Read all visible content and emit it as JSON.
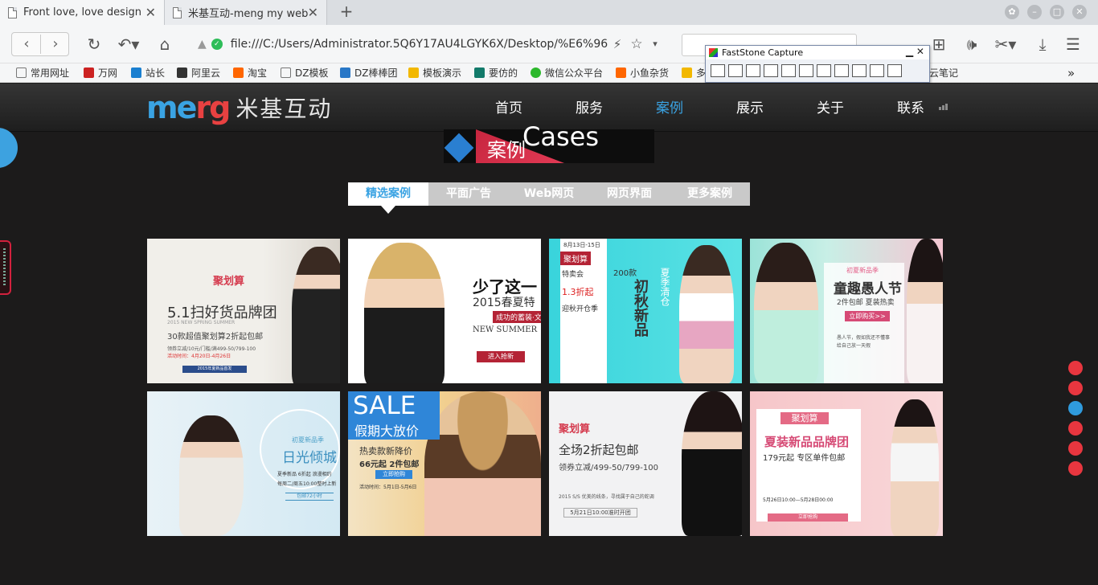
{
  "browser": {
    "tabs": [
      {
        "label": "Front love, love design"
      },
      {
        "label": "米基互动-meng my web..."
      }
    ],
    "address": "file:///C:/Users/Administrator.5Q6Y17AU4LGYK6X/Desktop/%E6%96",
    "bookmarks": [
      "常用网址",
      "万网",
      "站长",
      "阿里云",
      "淘宝",
      "DZ模板",
      "DZ棒棒团",
      "模板演示",
      "要仿的",
      "微信公众平台",
      "小鱼杂货",
      "多",
      "云笔记"
    ]
  },
  "faststone": {
    "title": "FastStone Capture"
  },
  "site": {
    "logo_en": "merg",
    "logo_cn": "米基互动",
    "menu": [
      "首页",
      "服务",
      "案例",
      "展示",
      "关于",
      "联系"
    ],
    "heading_cn": "案例",
    "heading_en": "Cases",
    "filters": [
      "精选案例",
      "平面广告",
      "Web网页",
      "网页界面",
      "更多案例"
    ],
    "cases": [
      {
        "title": "聚划算",
        "line1": "5.1扫好货品牌团",
        "line2": "2015 NEW SPRING SUMMER",
        "line3": "30款超值聚划算2折起包邮",
        "line4": "领券立减/10元/门槛/满499-50/799-100",
        "line5": "活动时间：4月20日-4月26日",
        "line6": "2015年夏新品首发"
      },
      {
        "title": "少了这一",
        "line1": "2015春夏特",
        "line2": "成功的蓄装·文",
        "line3": "NEW SUMMER",
        "btn": "进入抢新"
      },
      {
        "title": "8月13日-15日",
        "line1": "聚划算",
        "line2": "特卖会",
        "line3": "1.3折起",
        "line4": "迎秋开仓季",
        "line5": "200款",
        "line6": "初秋新品",
        "line7": "夏季清仓"
      },
      {
        "title": "初夏新品季",
        "line1": "童趣愚人节",
        "line2": "2件包邮   夏装热卖",
        "btn": "立即购买>>",
        "line3": "愚人节，假如我还不懂事",
        "line4": "给自己放一天假"
      },
      {
        "title": "初夏新品季",
        "line1": "日光倾城",
        "line2": "夏季新品 6折起 浪漫相约",
        "line3": "每周二/周五10:00整时上新",
        "btn": "包邮72小时"
      },
      {
        "title": "SALE",
        "line1": "假期大放价",
        "line2": "热卖款新降价",
        "line3": "66元起 2件包邮",
        "btn": "立即抢购",
        "line4": "活动时间：5月1日-5月6日"
      },
      {
        "title": "聚划算",
        "line1": "全场2折起包邮",
        "line2": "领券立减/499-50/799-100",
        "line3": "2015 S/S 优美的线条，寻找属于自己的蛇调",
        "line4": "5月21日10:00准时开团"
      },
      {
        "title": "聚划算",
        "line1": "夏装新品品牌团",
        "line2": "179元起   专区单件包邮",
        "line3": "5月26日10:00—5月28日00:00",
        "btn": "立即抢购"
      }
    ]
  },
  "colors": {
    "accent": "#3aa3e3",
    "red": "#e8363f",
    "bg": "#1c1b1b"
  }
}
